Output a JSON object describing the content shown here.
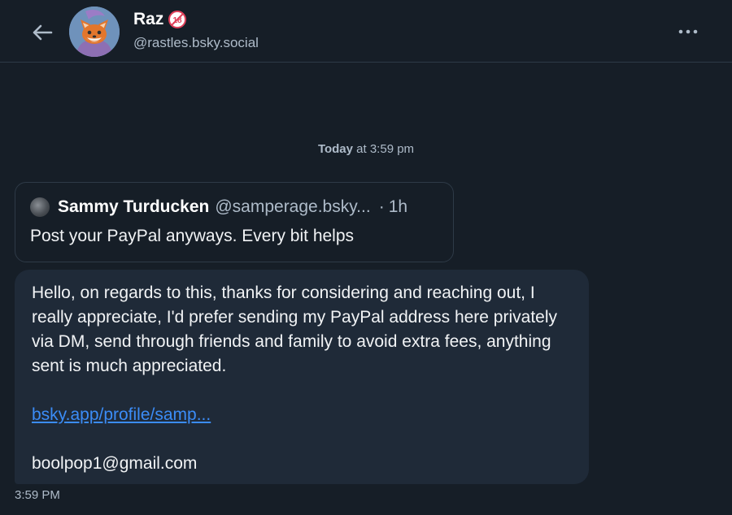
{
  "header": {
    "display_name": "Raz",
    "handle": "@rastles.bsky.social",
    "back_icon": "arrow-left-icon",
    "more_icon": "ellipsis-icon",
    "badge_icon": "adult-content-18-icon"
  },
  "conversation": {
    "date_label_bold": "Today",
    "date_label_rest": " at 3:59 pm",
    "quote": {
      "author_name": "Sammy Turducken",
      "author_handle": "@samperage.bsky...",
      "separator": "·",
      "age": "1h",
      "text": "Post your PayPal anyways. Every bit helps"
    },
    "message": {
      "text": "Hello, on regards to this, thanks for considering and reaching out, I really appreciate, I'd prefer sending my PayPal address here privately via DM, send through friends and family to avoid extra fees, anything sent is much appreciated.",
      "link_text": "bsky.app/profile/samp...",
      "email": "boolpop1@gmail.com",
      "time": "3:59 PM"
    }
  },
  "colors": {
    "background": "#161e27",
    "bubble": "#1f2a38",
    "link": "#3b8cf6",
    "muted_text": "#aebbc9"
  }
}
